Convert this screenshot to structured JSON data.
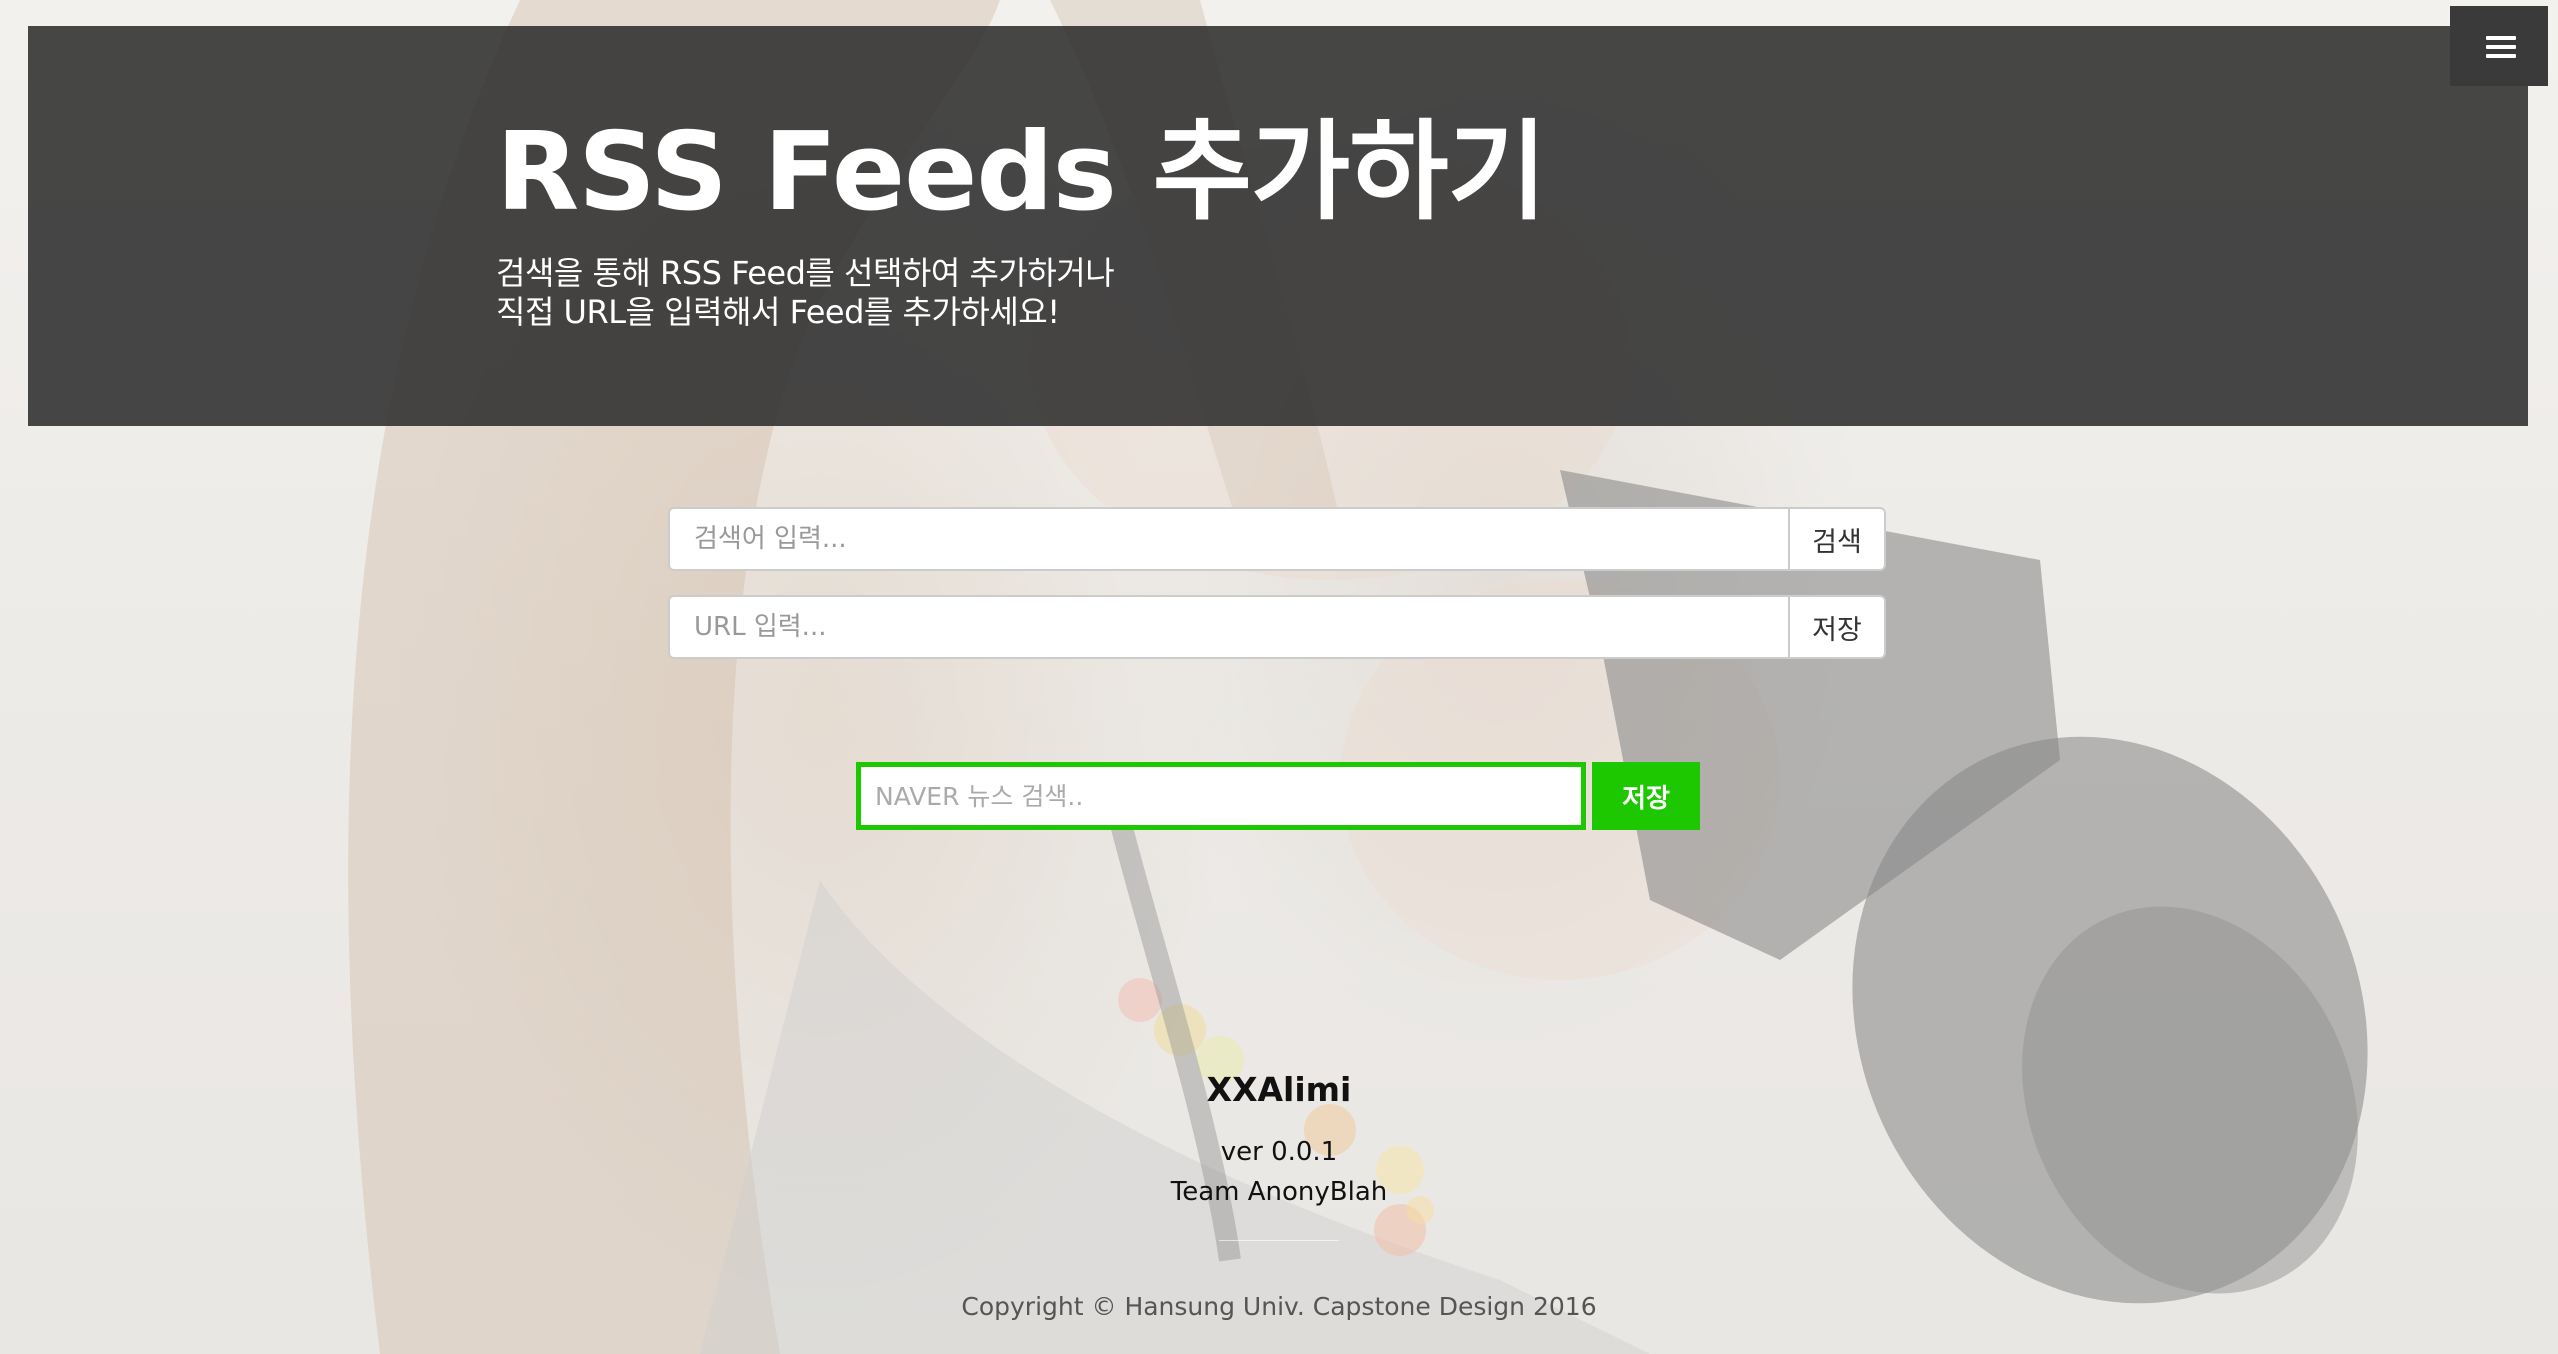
{
  "header": {
    "title": "RSS Feeds 추가하기",
    "subtitle_line1": "검색을 통해 RSS Feed를 선택하여 추가하거나",
    "subtitle_line2": "직접 URL을 입력해서 Feed를 추가하세요!"
  },
  "menu": {
    "icon": "hamburger-menu-icon"
  },
  "search": {
    "placeholder": "검색어 입력...",
    "value": "",
    "button_label": "검색"
  },
  "url_input": {
    "placeholder": "URL 입력...",
    "value": "",
    "button_label": "저장"
  },
  "naver": {
    "placeholder": "NAVER 뉴스 검색..",
    "value": "",
    "button_label": "저장",
    "accent_color": "#1ec800"
  },
  "footer": {
    "brand": "XXAlimi",
    "version": "ver 0.0.1",
    "team": "Team AnonyBlah",
    "copyright": "Copyright © Hansung Univ. Capstone Design 2016"
  },
  "colors": {
    "header_bg": "#2d2d2d",
    "menu_bg": "#3a3a3a",
    "text_on_dark": "#ffffff",
    "naver_green": "#1ec800"
  }
}
